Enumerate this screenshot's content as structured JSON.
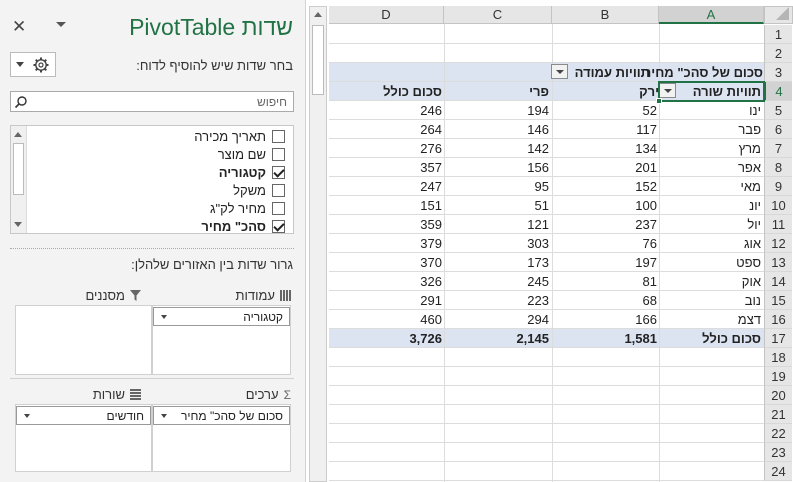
{
  "pane": {
    "close_glyph": "✕",
    "title": "שדות PivotTable",
    "choose_fields_hint": "בחר שדות שיש להוסיף לדוח:",
    "search_placeholder": "חיפוש",
    "fields": [
      {
        "label": "תאריך מכירה",
        "checked": false,
        "bold": false
      },
      {
        "label": "שם מוצר",
        "checked": false,
        "bold": false
      },
      {
        "label": "קטגוריה",
        "checked": true,
        "bold": true
      },
      {
        "label": "משקל",
        "checked": false,
        "bold": false
      },
      {
        "label": "מחיר לק\"ג",
        "checked": false,
        "bold": false
      },
      {
        "label": "סהכ\" מחיר",
        "checked": true,
        "bold": true
      }
    ],
    "drag_hint": "גרור שדות בין האזורים שלהלן:",
    "areas": {
      "columns": {
        "label": "עמודות",
        "chip": "קטגוריה"
      },
      "filters": {
        "label": "מסננים"
      },
      "values": {
        "label": "ערכים",
        "chip": "סכום של סהכ\" מחיר"
      },
      "rows": {
        "label": "שורות",
        "chip": "חודשים"
      }
    }
  },
  "sheet": {
    "columns": [
      "D",
      "C",
      "B",
      "A"
    ],
    "selected_column": "A",
    "selected_row": 4,
    "row_numbers": [
      1,
      2,
      3,
      4,
      5,
      6,
      7,
      8,
      9,
      10,
      11,
      12,
      13,
      14,
      15,
      16,
      17,
      18,
      19,
      20,
      21,
      22,
      23,
      24
    ],
    "pivot": {
      "value_header": "סכום של סהכ\" מחיר",
      "column_labels_header": "תוויות עמודה",
      "row_labels_header": "תוויות שורה",
      "col_categories": [
        "ירק",
        "פרי",
        "סכום כולל"
      ],
      "rows": [
        {
          "label": "ינו",
          "b": "52",
          "c": "194",
          "d": "246"
        },
        {
          "label": "פבר",
          "b": "117",
          "c": "146",
          "d": "264"
        },
        {
          "label": "מרץ",
          "b": "134",
          "c": "142",
          "d": "276"
        },
        {
          "label": "אפר",
          "b": "201",
          "c": "156",
          "d": "357"
        },
        {
          "label": "מאי",
          "b": "152",
          "c": "95",
          "d": "247"
        },
        {
          "label": "יונ",
          "b": "100",
          "c": "51",
          "d": "151"
        },
        {
          "label": "יול",
          "b": "237",
          "c": "121",
          "d": "359"
        },
        {
          "label": "אוג",
          "b": "76",
          "c": "303",
          "d": "379"
        },
        {
          "label": "ספט",
          "b": "197",
          "c": "173",
          "d": "370"
        },
        {
          "label": "אוק",
          "b": "81",
          "c": "245",
          "d": "326"
        },
        {
          "label": "נוב",
          "b": "68",
          "c": "223",
          "d": "291"
        },
        {
          "label": "דצמ",
          "b": "166",
          "c": "294",
          "d": "460"
        }
      ],
      "total": {
        "label": "סכום כולל",
        "b": "1,581",
        "c": "2,145",
        "d": "3,726"
      }
    }
  }
}
